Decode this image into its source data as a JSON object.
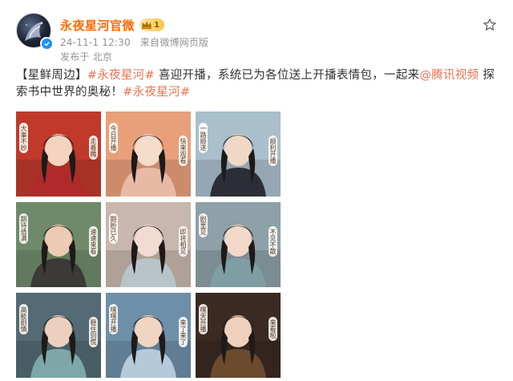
{
  "user": {
    "name": "永夜星河官微",
    "vip_level": "1",
    "verified": true
  },
  "meta": {
    "date": "24-11-1 12:30",
    "source": "来自微博网页版",
    "location": "发布于 北京"
  },
  "post": {
    "prefix": "【星鲜周边】",
    "hashtag1": "#永夜星河#",
    "text1": " 喜迎开播，系统已为各位送上开播表情包，一起来",
    "mention": "@腾讯视频",
    "text2": " 探索书中世界的奥秘！",
    "hashtag2": "#永夜星河#"
  },
  "grid": [
    {
      "caption_left": "大事不妙",
      "caption_right": "走着瞧",
      "bg": "#c0392b",
      "figure": "#f4d4c0",
      "robe": "#b02a2a"
    },
    {
      "caption_left": "今日开播",
      "caption_right": "快来观看",
      "bg": "#e9a07a",
      "figure": "#f6dccb",
      "robe": "#e8b9a4"
    },
    {
      "caption_left": "一路顺遂",
      "caption_right": "顺利开播",
      "bg": "#a9bfcc",
      "figure": "#f0d7c6",
      "robe": "#2b2e36"
    },
    {
      "caption_left": "期待值满",
      "caption_right": "速速来看",
      "bg": "#6f8a6a",
      "figure": "#eccab4",
      "robe": "#3b3a36"
    },
    {
      "caption_left": "期盼已久",
      "caption_right": "即将相见",
      "bg": "#c8b7ae",
      "figure": "#f2dbd0",
      "robe": "#b9c4c8"
    },
    {
      "caption_left": "剧里见",
      "caption_right": "不见不散",
      "bg": "#8ea0a8",
      "figure": "#f1d8c9",
      "robe": "#7e9ea4"
    },
    {
      "caption_left": "高能剧情",
      "caption_right": "稳住别慌",
      "bg": "#546a74",
      "figure": "#ecd0bd",
      "robe": "#7da7a8"
    },
    {
      "caption_left": "嘿嘿开播",
      "caption_right": "来了来了",
      "bg": "#6d8fa8",
      "figure": "#f0d5c2",
      "robe": "#b5c9db"
    },
    {
      "caption_left": "嘿天开播",
      "caption_right": "来看啦",
      "bg": "#3b2a22",
      "figure": "#efd0bc",
      "robe": "#6b4a2e"
    }
  ],
  "colors": {
    "username": "#ff6a00",
    "link": "#eb7350",
    "meta": "#939393",
    "verify": "#1e8fff"
  },
  "icons": {
    "verify": "verified-badge-icon",
    "favorite": "star-icon",
    "vip": "crown-icon",
    "video": "video-icon"
  }
}
